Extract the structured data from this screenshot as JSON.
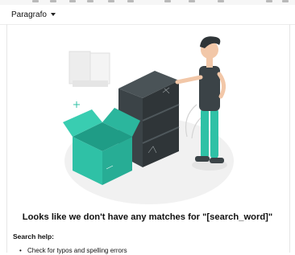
{
  "toolbar": {
    "format_selected": "Paragrafo",
    "icons": [
      "bold-icon",
      "italic-icon",
      "underline-icon",
      "strike-icon",
      "link-icon",
      "list-icon",
      "image-icon",
      "table-icon",
      "comment-icon",
      "undo-icon",
      "redo-icon"
    ]
  },
  "empty_state": {
    "illustration": "person-next-to-empty-shelf-and-open-box",
    "title": "Looks like we don't have any matches for \"[search_word]\"",
    "help_label": "Search help:",
    "tips": [
      "Check for typos and spelling errors"
    ]
  },
  "colors": {
    "accent_teal": "#2fc1a6",
    "shelf_dark": "#3b4347",
    "ground_blob": "#f2f2f2"
  }
}
